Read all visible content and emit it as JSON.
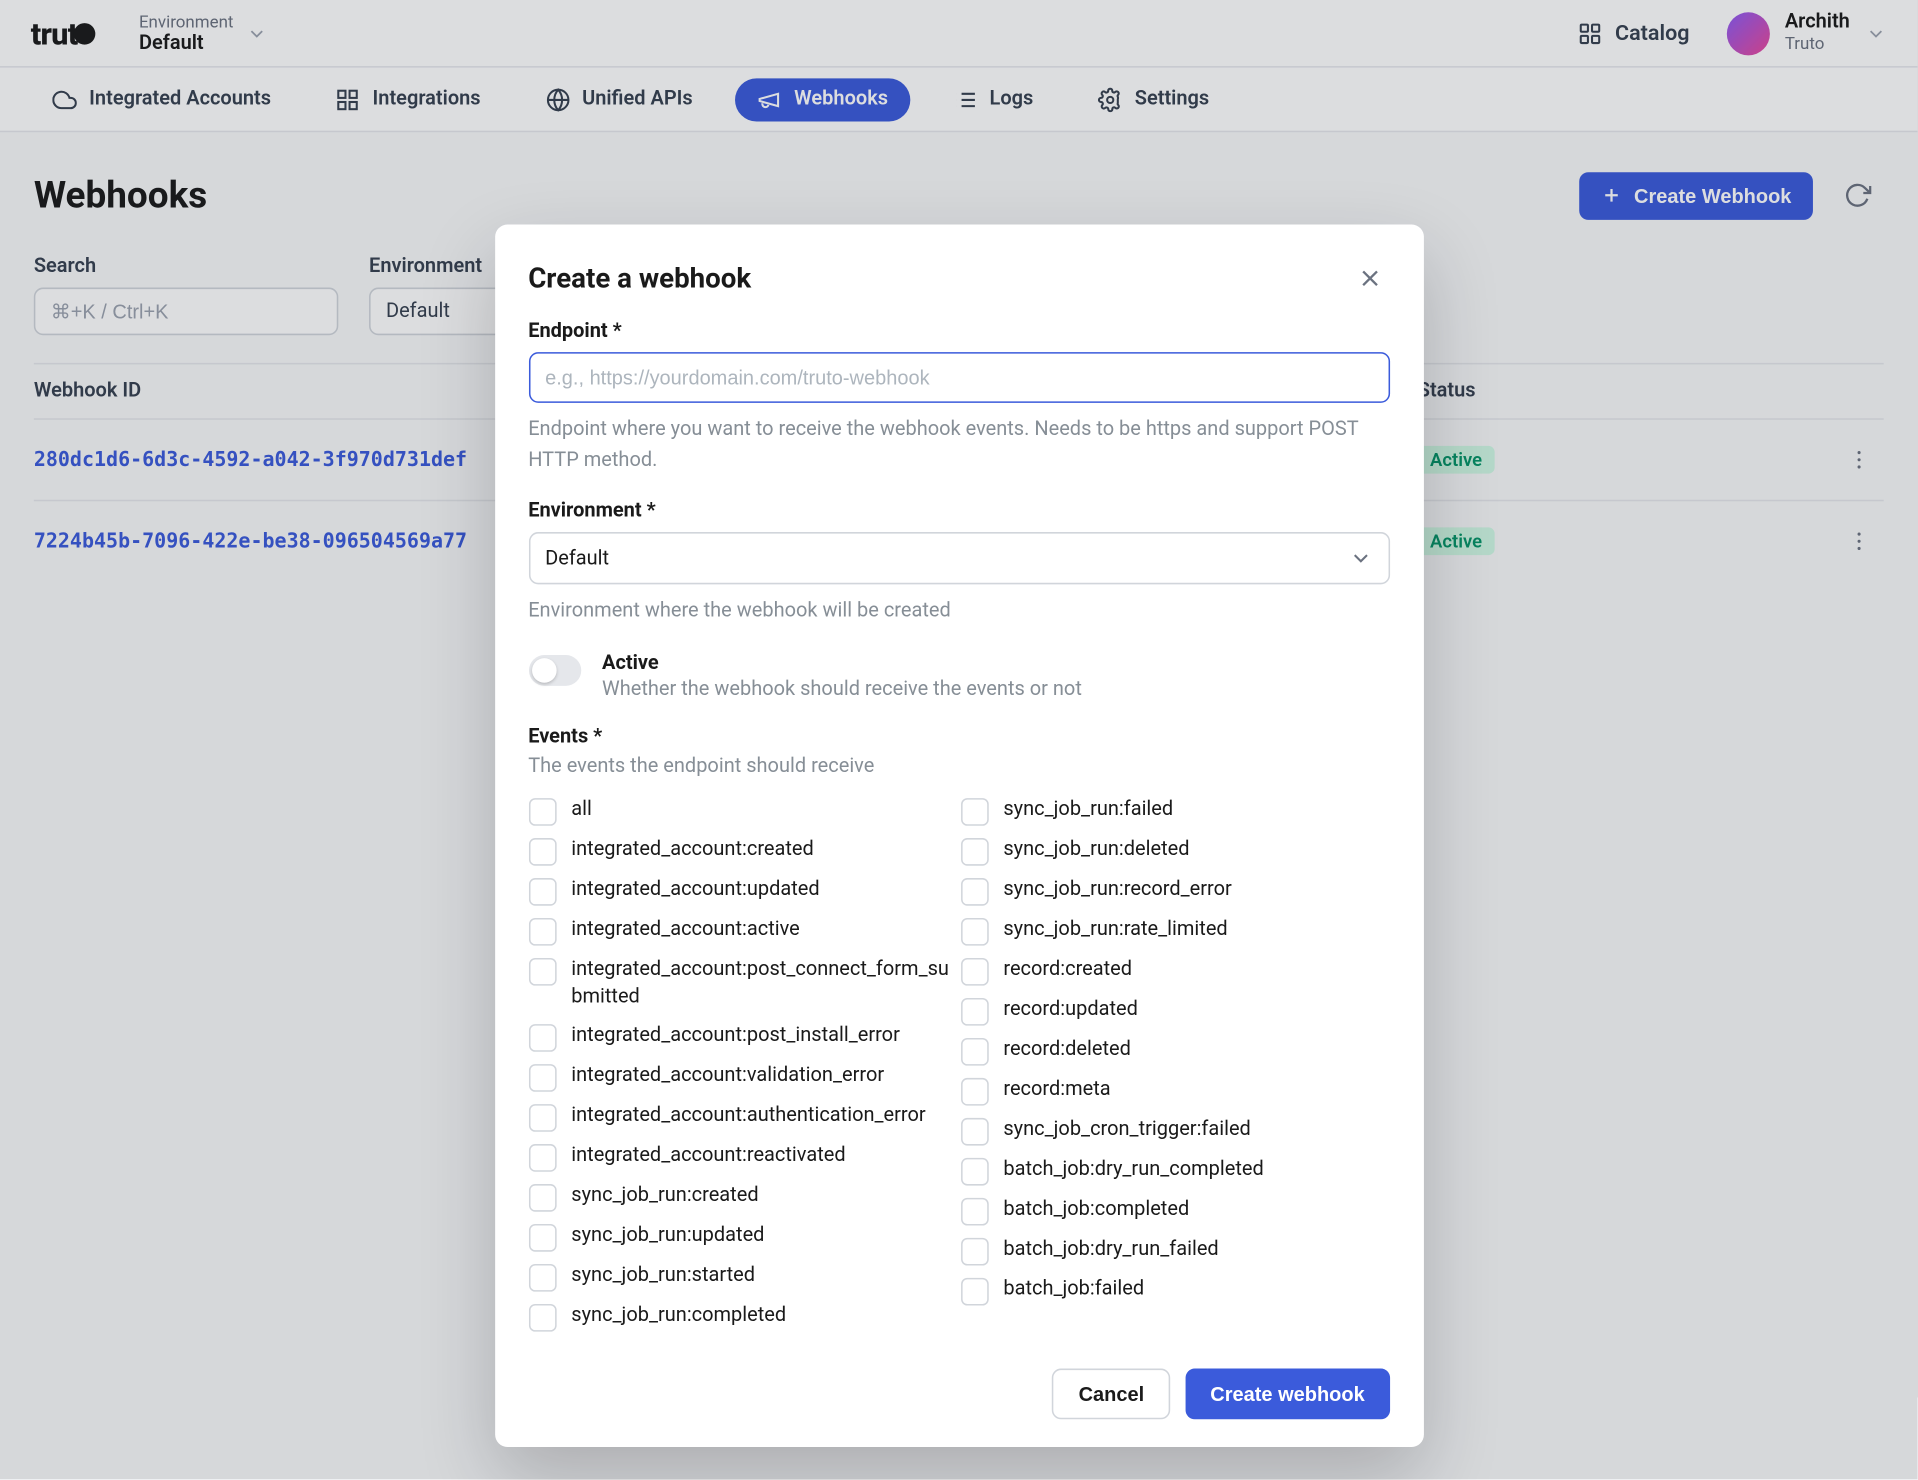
{
  "header": {
    "logo_text": "trut",
    "env_label": "Environment",
    "env_value": "Default",
    "catalog_label": "Catalog",
    "user_name": "Archith",
    "user_org": "Truto"
  },
  "nav": {
    "items": [
      {
        "label": "Integrated Accounts"
      },
      {
        "label": "Integrations"
      },
      {
        "label": "Unified APIs"
      },
      {
        "label": "Webhooks"
      },
      {
        "label": "Logs"
      },
      {
        "label": "Settings"
      }
    ]
  },
  "page": {
    "title": "Webhooks",
    "create_button": "Create Webhook",
    "filters": {
      "search_label": "Search",
      "search_placeholder": "⌘+K / Ctrl+K",
      "env_label": "Environment",
      "env_value": "Default"
    },
    "table": {
      "col_id": "Webhook ID",
      "col_status": "Status",
      "rows": [
        {
          "id": "280dc1d6-6d3c-4592-a042-3f970d731def",
          "status": "Active"
        },
        {
          "id": "7224b45b-7096-422e-be38-096504569a77",
          "status": "Active"
        }
      ]
    }
  },
  "modal": {
    "title": "Create a webhook",
    "endpoint_label": "Endpoint *",
    "endpoint_placeholder": "e.g., https://yourdomain.com/truto-webhook",
    "endpoint_help": "Endpoint where you want to receive the webhook events. Needs to be https and support POST HTTP method.",
    "env_label": "Environment *",
    "env_value": "Default",
    "env_help": "Environment where the webhook will be created",
    "active_title": "Active",
    "active_desc": "Whether the webhook should receive the events or not",
    "events_label": "Events *",
    "events_help": "The events the endpoint should receive",
    "events_left": [
      "all",
      "integrated_account:created",
      "integrated_account:updated",
      "integrated_account:active",
      "integrated_account:post_connect_form_submitted",
      "integrated_account:post_install_error",
      "integrated_account:validation_error",
      "integrated_account:authentication_error",
      "integrated_account:reactivated",
      "sync_job_run:created",
      "sync_job_run:updated",
      "sync_job_run:started",
      "sync_job_run:completed"
    ],
    "events_right": [
      "sync_job_run:failed",
      "sync_job_run:deleted",
      "sync_job_run:record_error",
      "sync_job_run:rate_limited",
      "record:created",
      "record:updated",
      "record:deleted",
      "record:meta",
      "sync_job_cron_trigger:failed",
      "batch_job:dry_run_completed",
      "batch_job:completed",
      "batch_job:dry_run_failed",
      "batch_job:failed"
    ],
    "cancel_button": "Cancel",
    "submit_button": "Create webhook"
  }
}
